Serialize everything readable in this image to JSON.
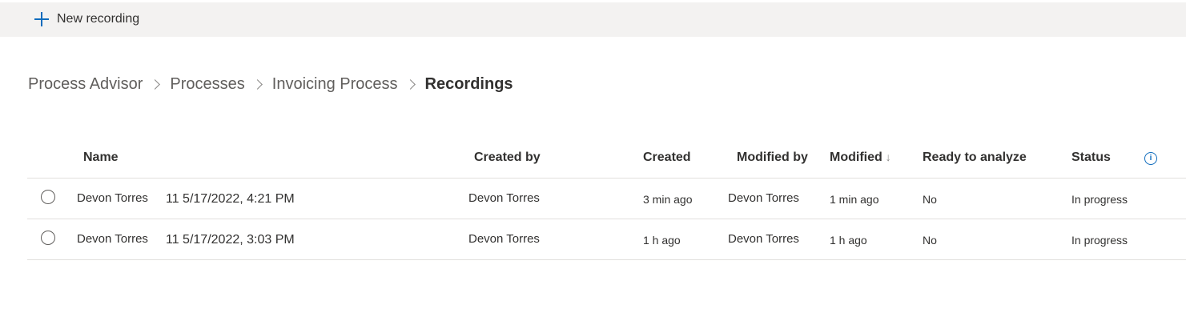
{
  "toolbar": {
    "new_recording_label": "New recording",
    "icon": "add-icon"
  },
  "breadcrumb": {
    "items": [
      "Process Advisor",
      "Processes",
      "Invoicing Process"
    ],
    "current": "Recordings"
  },
  "table": {
    "columns": {
      "name": "Name",
      "created_by": "Created by",
      "created": "Created",
      "modified_by": "Modified by",
      "modified": "Modified",
      "modified_sort": "↓",
      "ready": "Ready to analyze",
      "status": "Status"
    },
    "info_icon_glyph": "i",
    "rows": [
      {
        "name": "Devon Torres",
        "name_detail": "11 5/17/2022, 4:21 PM",
        "created_by": "Devon Torres",
        "created": "3 min ago",
        "modified_by": "Devon Torres",
        "modified": "1 min ago",
        "ready": "No",
        "status": "In progress"
      },
      {
        "name": "Devon Torres",
        "name_detail": "11 5/17/2022, 3:03 PM",
        "created_by": "Devon Torres",
        "created": "1 h ago",
        "modified_by": "Devon Torres",
        "modified": "1 h ago",
        "ready": "No",
        "status": "In progress"
      }
    ]
  },
  "colors": {
    "accent": "#0f6cbd",
    "toolbar_bg": "#f3f2f1",
    "text": "#323130",
    "muted_text": "#605e5c",
    "divider": "#e1dfdd"
  }
}
